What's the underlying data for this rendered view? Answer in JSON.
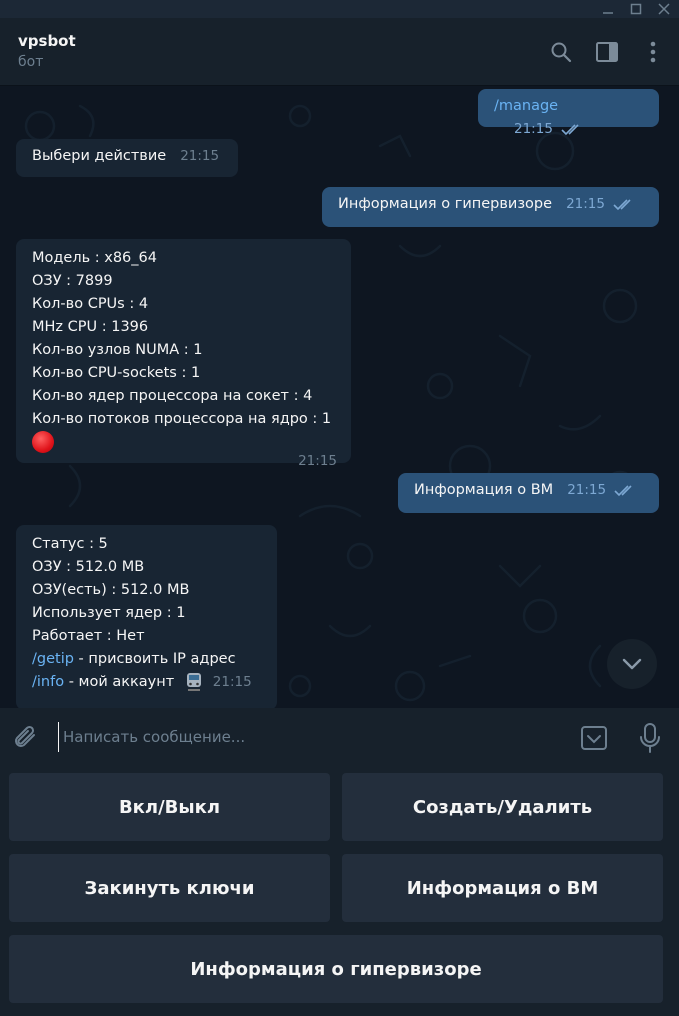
{
  "window": {
    "minimize_icon": "minimize-icon",
    "maximize_icon": "maximize-icon",
    "close_icon": "close-icon"
  },
  "header": {
    "title": "vpsbot",
    "subtitle": "бот",
    "icons": [
      "search-icon",
      "sidebar-toggle-icon",
      "more-vert-icon"
    ]
  },
  "messages": {
    "m1": {
      "text": "/manage",
      "time": "21:15"
    },
    "m2": {
      "text": "Выбери действие",
      "time": "21:15"
    },
    "m3": {
      "text": "Информация о гипервизоре",
      "time": "21:15"
    },
    "m4": {
      "lines": [
        "Модель : x86_64",
        "ОЗУ : 7899",
        "Кол-во CPUs : 4",
        "MHz CPU : 1396",
        "Кол-во узлов NUMA : 1",
        "Кол-во CPU-sockets : 1",
        "Кол-во ядер процессора на сокет : 4",
        "Кол-во потоков процессора на ядро : 1"
      ],
      "emoji": "red-circle",
      "time": "21:15"
    },
    "m5": {
      "text": "Информация о ВМ",
      "time": "21:15"
    },
    "m6": {
      "lines": [
        "Статус : 5",
        "ОЗУ : 512.0 MB",
        "ОЗУ(есть) : 512.0 MB",
        "Использует ядер : 1",
        "Работает : Нет"
      ],
      "cmd1": "/getip",
      "cmd1_desc": " - присвоить IP адрес",
      "cmd2": "/info",
      "cmd2_desc": " - мой аккаунт",
      "emoji": "train-icon",
      "time": "21:15"
    }
  },
  "composer": {
    "placeholder": "Написать сообщение..."
  },
  "keyboard": {
    "buttons": [
      "Вкл/Выкл",
      "Создать/Удалить",
      "Закинуть ключи",
      "Информация о ВМ",
      "Информация о гипервизоре"
    ]
  },
  "colors": {
    "background": "#0e1621",
    "panel": "#17212b",
    "incoming_bubble": "#182533",
    "outgoing_bubble": "#2b5278",
    "link": "#6ab3f3",
    "keyboard_button": "#232e3c"
  }
}
